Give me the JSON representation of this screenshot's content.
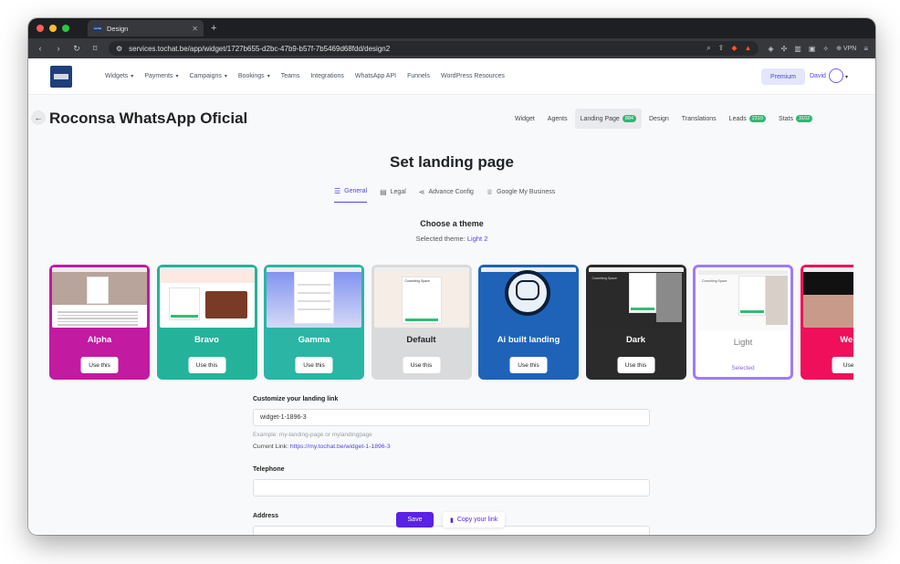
{
  "browser": {
    "tab_title": "Design",
    "tab_favicon_text": "tochat",
    "url": "services.tochat.be/app/widget/1727b655-d2bc-47b9-b57f-7b5469d68fdd/design2",
    "vpn_label": "VPN"
  },
  "nav": {
    "menu": [
      "Widgets",
      "Payments",
      "Campaigns",
      "Bookings",
      "Teams",
      "Integrations",
      "WhatsApp API",
      "Funnels",
      "WordPress Resources"
    ],
    "menu_caret": [
      true,
      true,
      true,
      true,
      false,
      false,
      false,
      false,
      false
    ],
    "premium_label": "Premium",
    "user_name": "David"
  },
  "widget": {
    "title": "Roconsa WhatsApp Oficial",
    "tabs": [
      {
        "label": "Widget",
        "badge": ""
      },
      {
        "label": "Agents",
        "badge": ""
      },
      {
        "label": "Landing Page",
        "badge": "884"
      },
      {
        "label": "Design",
        "badge": ""
      },
      {
        "label": "Translations",
        "badge": ""
      },
      {
        "label": "Leads",
        "badge": "2310"
      },
      {
        "label": "Stats",
        "badge": "3102"
      }
    ]
  },
  "landing": {
    "title": "Set landing page",
    "tabs": [
      {
        "label": "General",
        "icon": "sliders-icon"
      },
      {
        "label": "Legal",
        "icon": "document-icon"
      },
      {
        "label": "Advance Config",
        "icon": "share-icon"
      },
      {
        "label": "Google My Business",
        "icon": "trophy-icon"
      }
    ],
    "choose_title": "Choose a theme",
    "selected_prefix": "Selected theme:",
    "selected_value": "Light 2"
  },
  "themes": [
    {
      "name": "Alpha",
      "button": "Use this",
      "color": "#c21aa1"
    },
    {
      "name": "Bravo",
      "button": "Use this",
      "color": "#24b39a"
    },
    {
      "name": "Gamma",
      "button": "Use this",
      "color": "#2bb5a5"
    },
    {
      "name": "Default",
      "button": "Use this",
      "color": "#d9dadb"
    },
    {
      "name": "Ai built landing",
      "button": "Use this",
      "color": "#1e63b8"
    },
    {
      "name": "Dark",
      "button": "Use this",
      "color": "#2b2b2b"
    },
    {
      "name": "Light",
      "button": "Selected",
      "color": "#ffffff"
    },
    {
      "name": "Webi",
      "button": "Use t",
      "color": "#ef0f5a"
    }
  ],
  "preview_text": {
    "coworking": "Coworking Space"
  },
  "form": {
    "link_label": "Customize your landing link",
    "link_value": "widget-1-1896-3",
    "link_hint": "Example: my-landing-page or mylandingpage",
    "current_prefix": "Current Link:",
    "current_url": "https://my.tochat.be/widget-1-1896-3",
    "telephone_label": "Telephone",
    "telephone_value": "",
    "address_label": "Address",
    "address_value": ""
  },
  "actions": {
    "save": "Save",
    "copy": "Copy your link"
  }
}
